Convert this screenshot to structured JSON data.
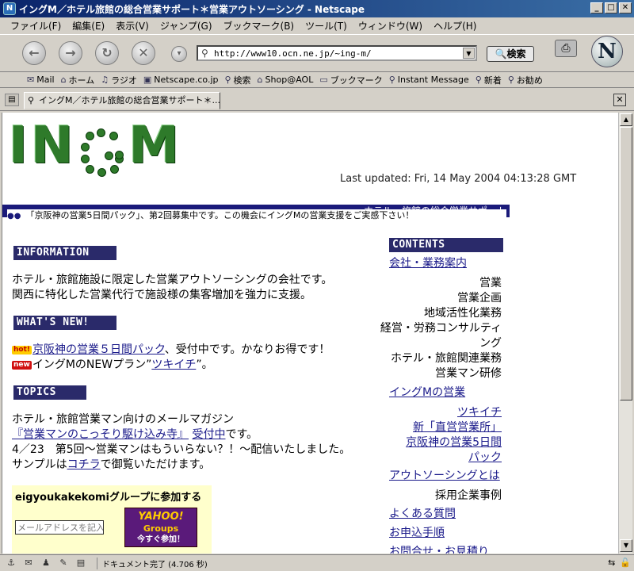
{
  "window": {
    "title": "イングM／ホテル旅館の総合営業サポート＊営業アウトソーシング - Netscape",
    "minimize": "_",
    "maximize": "□",
    "close": "✕"
  },
  "menu": [
    "ファイル(F)",
    "編集(E)",
    "表示(V)",
    "ジャンプ(G)",
    "ブックマーク(B)",
    "ツール(T)",
    "ウィンドウ(W)",
    "ヘルプ(H)"
  ],
  "navbar": {
    "url": "http://www10.ocn.ne.jp/~ing-m/",
    "search_label": "検索",
    "logo": "N"
  },
  "personal_toolbar": [
    "Mail",
    "ホーム",
    "ラジオ",
    "Netscape.co.jp",
    "検索",
    "Shop@AOL",
    "ブックマーク",
    "Instant Message",
    "新着",
    "お勧め"
  ],
  "tab": {
    "label": "イングM／ホテル旅館の総合営業サポート＊..."
  },
  "page": {
    "logo_left": "IN",
    "logo_right": "M",
    "updated": "Last updated: Fri, 14 May 2004 04:13:28 GMT",
    "banner_text": "ホテル・旅館の総合営業サポート",
    "ticker": "「京阪神の営業5日間パック」、第2回募集中です。この機会にイングMの営業支援をご実感下さい！",
    "information_header": "INFORMATION",
    "info_line1": "ホテル・旅館施設に限定した営業アウトソーシングの会社です。",
    "info_line2": "関西に特化した営業代行で施設様の集客増加を強力に支援。",
    "whatsnew_header": "WHAT'S NEW!",
    "news1_badge": "hot!",
    "news1_link": "京阪神の営業５日間パック",
    "news1_rest": "、受付中です。かなりお得です！",
    "news2_badge": "new",
    "news2_pre": "イングMのNEWプラン”",
    "news2_link": "ツキイチ",
    "news2_post": "”。",
    "topics_header": "TOPICS",
    "topic_line1": "ホテル・旅館営業マン向けのメールマガジン",
    "topic_line2_link": "『営業マンのこっそり駆け込み寺』",
    "topic_line2_link2": "受付中",
    "topic_line2_post": "です。",
    "topic_line3": "4／23　第5回〜営業マンはもういらない？！〜配信いたしました。",
    "topic_line4_pre": "サンプルは",
    "topic_line4_link": "コチラ",
    "topic_line4_post": "で御覧いただけます。",
    "yahoo_title": "eigyoukakekomiグループに参加する",
    "yahoo_placeholder": "メールアドレスを記入し",
    "yahoo_logo1": "YAHOO!",
    "yahoo_logo2": "Groups",
    "yahoo_join": "今すぐ参加！"
  },
  "contents": {
    "header": "CONTENTS",
    "company_link": "会社・業務案内",
    "company_items": [
      "営業",
      "営業企画",
      "地域活性化業務",
      "経営・労務コンサルティ",
      "ング",
      "ホテル・旅館関連業務",
      "営業マン研修"
    ],
    "ingm_link": "イングMの営業",
    "ingm_items": [
      "ツキイチ",
      "新「直営営業所」",
      "京阪神の営業5日間",
      "パック"
    ],
    "outsourcing_link": "アウトソーシングとは",
    "outsourcing_item": "採用企業事例",
    "faq_link": "よくある質問",
    "apply_link": "お申込手順",
    "contact_link": "お問合せ・お見積り"
  },
  "status": {
    "text": "ドキュメント完了 (4.706 秒)"
  }
}
